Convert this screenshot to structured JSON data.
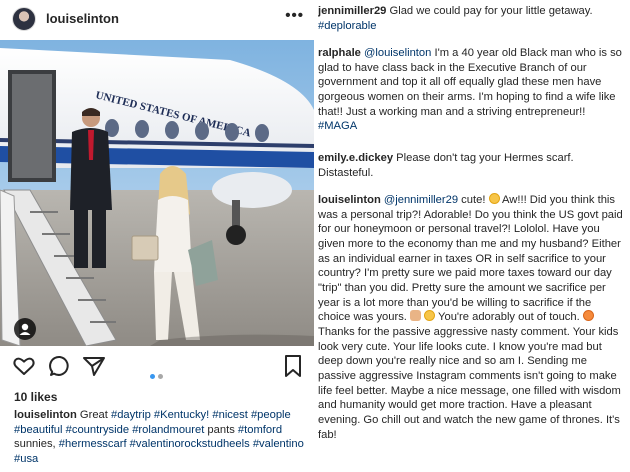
{
  "post": {
    "username": "louiselinton",
    "more": "•••",
    "photo_text": "UNITED STATES OF AMERICA",
    "likes": "10 likes",
    "caption": {
      "author": "louiselinton",
      "text_start": " Great ",
      "tags": [
        "#daytrip",
        "#Kentucky!",
        "#nicest",
        "#people",
        "#beautiful",
        "#countryside",
        "#rolandmouret",
        "#tomford",
        "#hermesscarf",
        "#valentinorockstudheels",
        "#valentino",
        "#usa"
      ],
      "pants": " pants ",
      "sunnies": " sunnies, "
    }
  },
  "comments": [
    {
      "handle": "jennimiller29",
      "text": " Glad we could pay for your little getaway. ",
      "tag": "#deplorable"
    },
    {
      "handle": "ralphale",
      "mention": "@louiselinton",
      "text": " I'm a 40 year old Black man who is so glad to have class back in the Executive Branch of our government and top it all off equally glad these men have gorgeous women on their arms. I'm hoping to find a wife like that!! Just a working man and a striving entrepreneur!! ",
      "tag": "#MAGA"
    },
    {
      "handle": "emily.e.dickey",
      "text": " Please don't tag your Hermes scarf. Distasteful."
    },
    {
      "handle": "louiselinton",
      "mention": "@jennimiller29",
      "part1": " cute! ",
      "part2": " Aw!!! Did you think this was a personal trip?! Adorable! Do you think the US govt paid for our honeymoon or personal travel?! Lololol. Have you given more to the economy than me and my husband? Either as an individual earner in taxes OR in self sacrifice to your country? I'm pretty sure we paid more taxes toward our day \"trip\" than you did. Pretty sure the amount we sacrifice per year is a lot more than you'd be willing to sacrifice if the choice was yours. ",
      "part3": " You're adorably out of touch. ",
      "part4": " Thanks for the passive aggressive nasty comment. Your kids look very cute. Your life looks cute. I know you're mad but deep down you're really nice and so am I. Sending me passive aggressive Instagram comments isn't going to make life feel better. Maybe a nice message, one filled with wisdom and humanity would get more traction. Have a pleasant evening. Go chill out and watch the new game of thrones. It's fab!"
    }
  ],
  "icons": [
    "heart-icon",
    "comment-icon",
    "share-icon",
    "bookmark-icon",
    "person-tag-icon",
    "more-icon"
  ],
  "colors": {
    "text": "#262626",
    "link": "#003569",
    "carousel_active": "#3897f0",
    "carousel_inactive": "#a8a8a8"
  }
}
